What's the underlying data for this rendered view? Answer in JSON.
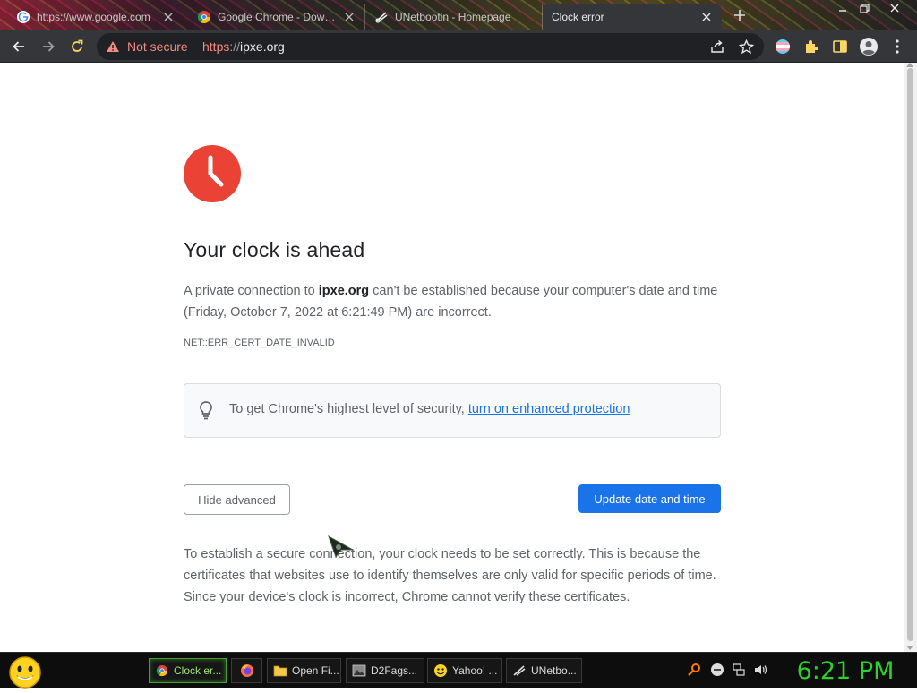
{
  "tabs": [
    {
      "title": "https://www.google.com",
      "favicon": "google-icon",
      "active": false
    },
    {
      "title": "Google Chrome - Download",
      "favicon": "chrome-icon",
      "active": false
    },
    {
      "title": "UNetbootin - Homepage",
      "favicon": "unetbootin-icon",
      "active": false
    },
    {
      "title": "Clock error",
      "favicon": "none",
      "active": true
    }
  ],
  "omnibox": {
    "security_label": "Not secure",
    "url_scheme": "https",
    "url_separator": "://",
    "url_host": "ipxe.org"
  },
  "interstitial": {
    "heading": "Your clock is ahead",
    "explanation_prefix": "A private connection to ",
    "explanation_host": "ipxe.org",
    "explanation_suffix": " can't be established because your computer's date and time (Friday, October 7, 2022 at 6:21:49 PM) are incorrect.",
    "error_code": "NET::ERR_CERT_DATE_INVALID",
    "promo_text": "To get Chrome's highest level of security, ",
    "promo_link": "turn on enhanced protection",
    "hide_advanced_label": "Hide advanced",
    "primary_button_label": "Update date and time",
    "details": "To establish a secure connection, your clock needs to be set correctly. This is because the certificates that websites use to identify themselves are only valid for specific periods of time. Since your device's clock is incorrect, Chrome cannot verify these certificates."
  },
  "taskbar": {
    "tasks": [
      {
        "label": "Clock er...",
        "icon": "chrome-icon",
        "active": true
      },
      {
        "label": "",
        "icon": "firefox-icon",
        "active": false
      },
      {
        "label": "Open Fi...",
        "icon": "folder-icon",
        "active": false
      },
      {
        "label": "D2Fags...",
        "icon": "image-icon",
        "active": false
      },
      {
        "label": "Yahoo! ...",
        "icon": "yahoo-icon",
        "active": false
      },
      {
        "label": "UNetbo...",
        "icon": "unetbootin-icon",
        "active": false
      }
    ],
    "clock": "6:21 PM"
  },
  "colors": {
    "error_red": "#ea4335",
    "primary_blue": "#1a73e8",
    "clock_green": "#2ad22a",
    "toolbar_dark": "#35363a"
  }
}
